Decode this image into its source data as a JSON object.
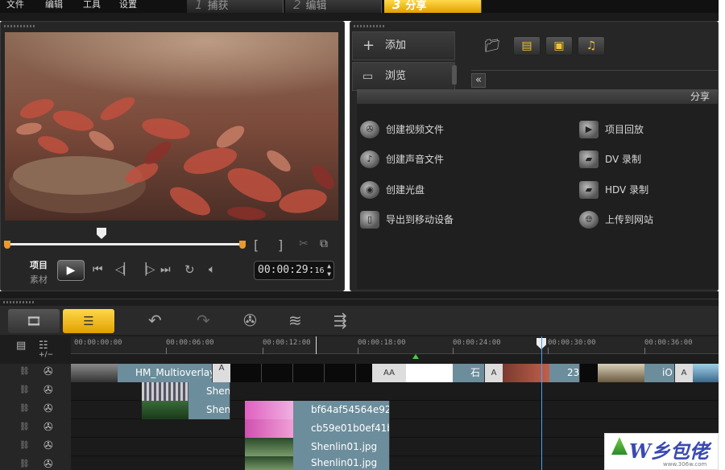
{
  "menu": {
    "file": "文件",
    "edit": "编辑",
    "tools": "工具",
    "settings": "设置"
  },
  "steps": [
    {
      "num": "1",
      "label": "捕获"
    },
    {
      "num": "2",
      "label": "编辑"
    },
    {
      "num": "3",
      "label": "分享"
    }
  ],
  "preview": {
    "mode_project": "项目",
    "mode_clip": "素材",
    "timecode": "00:00:29:",
    "timecode_frames": "16",
    "mark_in": "[",
    "mark_out": "]"
  },
  "library": {
    "add_label": "添加",
    "browse_label": "浏览",
    "share_header": "分享",
    "collapse_glyph": "«"
  },
  "share_options_left": [
    {
      "icon": "film-reel-icon",
      "label": "创建视频文件"
    },
    {
      "icon": "audio-disc-icon",
      "label": "创建声音文件"
    },
    {
      "icon": "disc-icon",
      "label": "创建光盘"
    },
    {
      "icon": "mobile-device-icon",
      "label": "导出到移动设备"
    }
  ],
  "share_options_right": [
    {
      "icon": "project-playback-icon",
      "label": "项目回放"
    },
    {
      "icon": "dv-camera-icon",
      "label": "DV 录制"
    },
    {
      "icon": "hdv-camera-icon",
      "label": "HDV 录制"
    },
    {
      "icon": "globe-icon",
      "label": "上传到网站"
    }
  ],
  "timeline": {
    "ruler_ticks": [
      "00:00:00:00",
      "00:00:06:00",
      "00:00:12:00",
      "00:00:18:00",
      "00:00:24:00",
      "00:00:30:00",
      "00:00:36:00"
    ],
    "zoom_label": "+/−",
    "clips": {
      "video_main": "HM_Multioverlay",
      "shi_partial": "石",
      "num_partial": "23",
      "ios_partial": "iO",
      "shen1": "Shen",
      "shen2": "Shen",
      "ov1": "bf64af54564e925",
      "ov2": "cb59e01b0ef41b",
      "ov3": "Shenlin01.jpg",
      "ov4": "Shenlin01.jpg"
    }
  },
  "watermark": {
    "text": "W乡包佬",
    "url": "www.306w.com"
  }
}
